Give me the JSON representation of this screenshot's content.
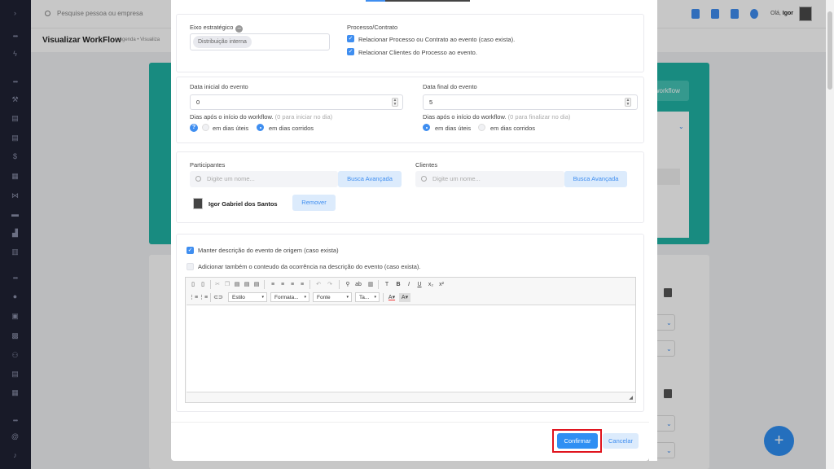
{
  "topbar": {
    "search_placeholder": "Pesquise pessoa ou empresa",
    "user_greeting": "Olá,",
    "user_name": "Igor"
  },
  "subbar": {
    "page_title": "Visualizar WorkFlow",
    "breadcrumb": "Agenda • Visualiza"
  },
  "background": {
    "workflow_button": "o workflow"
  },
  "modal": {
    "eixo": {
      "label": "Eixo estratégico",
      "tag": "Distribuição interna"
    },
    "processo": {
      "label": "Processo/Contrato",
      "opt1": "Relacionar Processo ou Contrato ao evento (caso exista).",
      "opt2": "Relacionar Clientes do Processo ao evento."
    },
    "data_inicial": {
      "label": "Data inicial do evento",
      "value": "0",
      "help": "Dias após o início do workflow.",
      "help_hint": "(0 para iniciar no dia)",
      "radio_uteis": "em dias úteis",
      "radio_corridos": "em dias corridos"
    },
    "data_final": {
      "label": "Data final do evento",
      "value": "5",
      "help": "Dias após o início do workflow.",
      "help_hint": "(0 para finalizar no dia)",
      "radio_uteis": "em dias úteis",
      "radio_corridos": "em dias corridos"
    },
    "participantes": {
      "label": "Participantes",
      "placeholder": "Digite um nome...",
      "search_button": "Busca Avançada",
      "person_name": "Igor Gabriel dos Santos",
      "remove_button": "Remover"
    },
    "clientes": {
      "label": "Clientes",
      "placeholder": "Digite um nome...",
      "search_button": "Busca Avançada"
    },
    "descricao": {
      "opt_manter": "Manter descrição do evento de origem (caso exista)",
      "opt_adicionar": "Adicionar também o conteudo da ocorrência na descrição do evento (caso exista)."
    },
    "editor": {
      "drop_estilo": "Estilo",
      "drop_formato": "Formata...",
      "drop_fonte": "Fonte",
      "drop_tamanho": "Ta...",
      "btn_bold": "B",
      "btn_italic": "I",
      "btn_underline": "U",
      "btn_sub": "x₂",
      "btn_sup": "x²",
      "btn_text_color": "A",
      "btn_bg_color": "A"
    },
    "footer": {
      "confirm": "Confirmar",
      "cancel": "Cancelar"
    }
  },
  "colors": {
    "accent": "#2f8ff3",
    "teal": "#1fb3a4",
    "highlight_border": "#e0141e",
    "sidebar": "#1f2234"
  }
}
